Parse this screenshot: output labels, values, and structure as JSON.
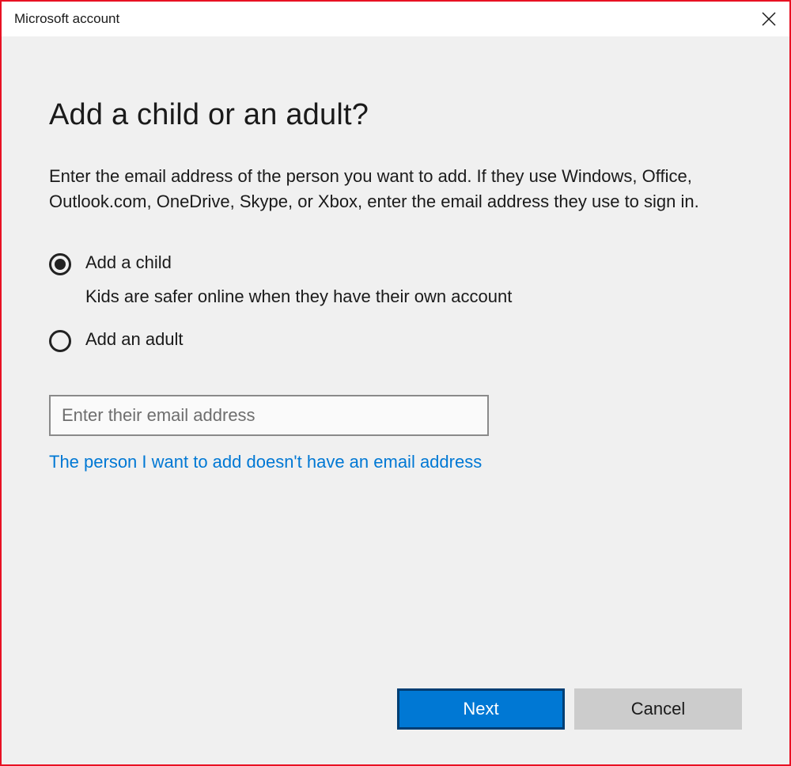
{
  "titlebar": {
    "title": "Microsoft account"
  },
  "main": {
    "heading": "Add a child or an adult?",
    "description": "Enter the email address of the person you want to add. If they use Windows, Office, Outlook.com, OneDrive, Skype, or Xbox, enter the email address they use to sign in.",
    "options": {
      "child": {
        "label": "Add a child",
        "subtext": "Kids are safer online when they have their own account",
        "selected": true
      },
      "adult": {
        "label": "Add an adult",
        "selected": false
      }
    },
    "email": {
      "placeholder": "Enter their email address",
      "value": ""
    },
    "no_email_link": "The person I want to add doesn't have an email address"
  },
  "buttons": {
    "next": "Next",
    "cancel": "Cancel"
  }
}
